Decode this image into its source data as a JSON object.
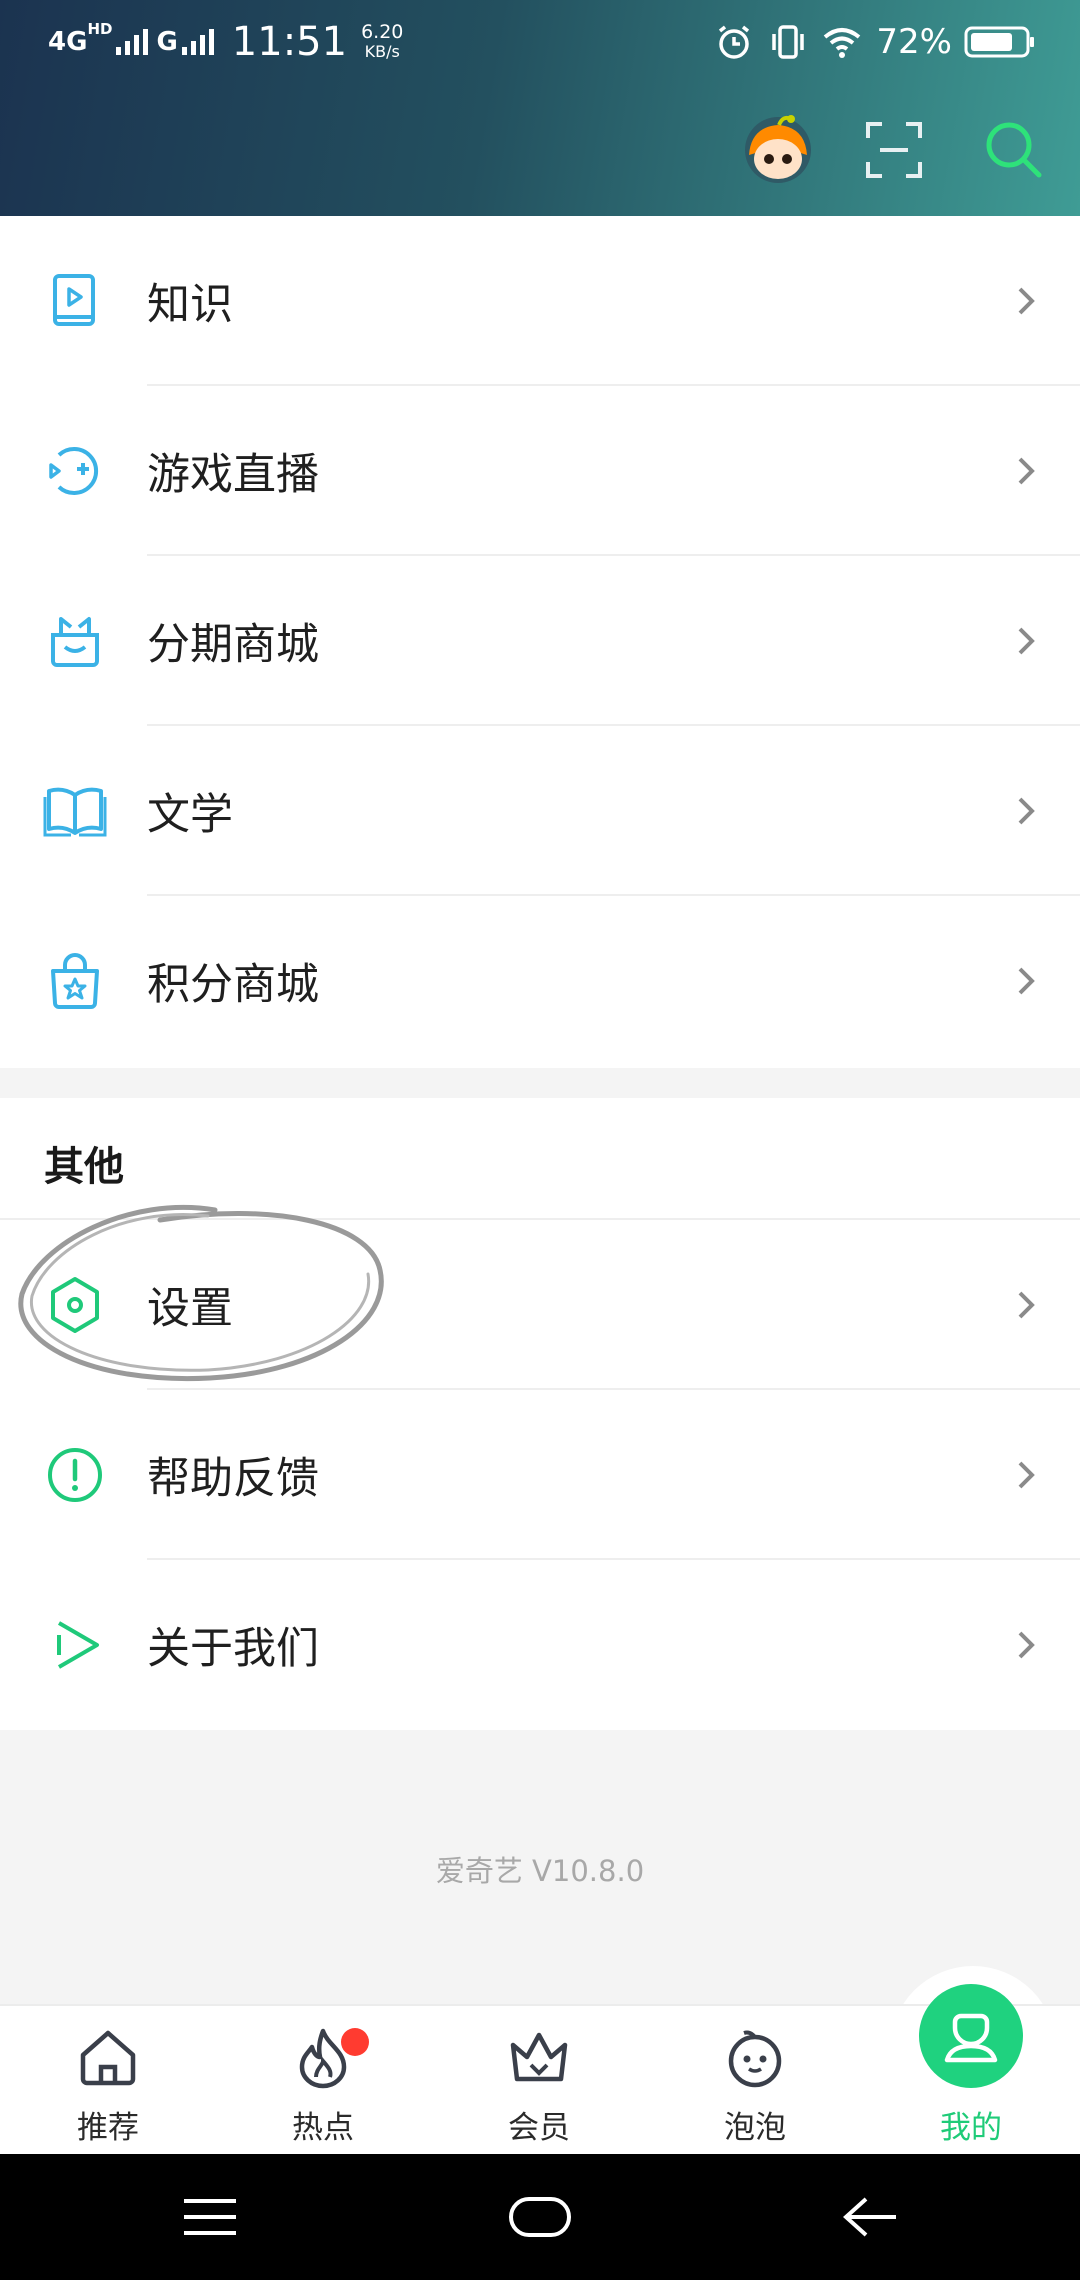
{
  "status_bar": {
    "network": "4G",
    "network_sup": "HD",
    "network2": "G",
    "time": "11:51",
    "speed_value": "6.20",
    "speed_unit": "KB/s",
    "battery": "72%"
  },
  "header": {
    "avatar_icon": "avatar-icon",
    "scan_icon": "scan-icon",
    "search_icon": "search-icon"
  },
  "services": {
    "items": [
      {
        "label": "知识",
        "icon": "knowledge-icon"
      },
      {
        "label": "游戏直播",
        "icon": "game-live-icon"
      },
      {
        "label": "分期商城",
        "icon": "installment-mall-icon"
      },
      {
        "label": "文学",
        "icon": "literature-icon"
      },
      {
        "label": "积分商城",
        "icon": "points-mall-icon"
      }
    ]
  },
  "other": {
    "title": "其他",
    "items": [
      {
        "label": "设置",
        "icon": "settings-icon"
      },
      {
        "label": "帮助反馈",
        "icon": "help-feedback-icon"
      },
      {
        "label": "关于我们",
        "icon": "about-icon"
      }
    ]
  },
  "version": "爱奇艺 V10.8.0",
  "tabs": [
    {
      "label": "推荐",
      "icon": "home-icon"
    },
    {
      "label": "热点",
      "icon": "flame-icon"
    },
    {
      "label": "会员",
      "icon": "crown-icon"
    },
    {
      "label": "泡泡",
      "icon": "bubble-icon"
    },
    {
      "label": "我的",
      "icon": "profile-icon",
      "active": true
    }
  ],
  "colors": {
    "accent_blue": "#3bb2e6",
    "accent_green": "#1fd27f",
    "badge_red": "#ff3b30"
  }
}
